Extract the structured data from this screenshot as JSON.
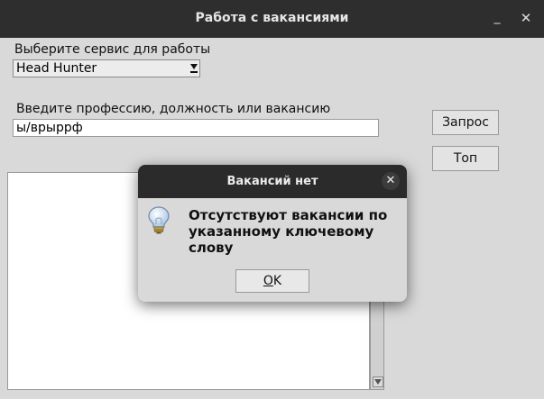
{
  "window": {
    "title": "Работа с вакансиями",
    "minimize_glyph": "_",
    "close_glyph": "✕"
  },
  "service": {
    "label": "Выберите сервис для работы",
    "selected": "Head Hunter"
  },
  "query": {
    "label": "Введите профессию, должность или вакансию",
    "value": "ы/врыррф"
  },
  "buttons": {
    "request": "Запрос",
    "top": "Топ"
  },
  "dialog": {
    "title": "Вакансий нет",
    "close_glyph": "✕",
    "message": "Отсутствуют вакансии по указанному ключевому слову",
    "icon": "lightbulb-icon",
    "ok_underlined": "O",
    "ok_rest": "K"
  },
  "colors": {
    "titlebar": "#2e2e2e",
    "window_bg": "#d9d9d9"
  }
}
